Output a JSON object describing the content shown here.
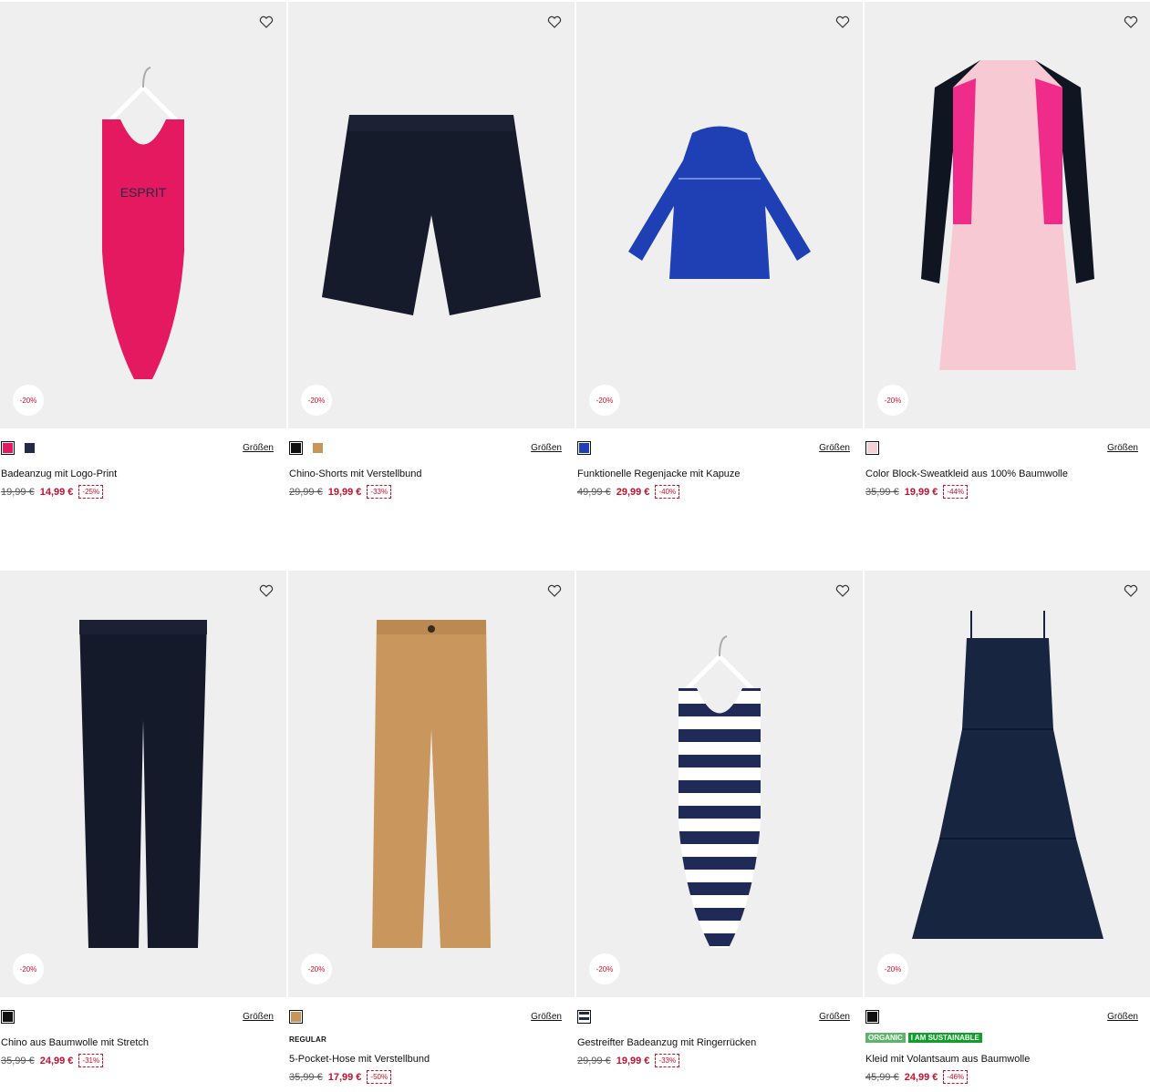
{
  "labels": {
    "sizes": "Größen"
  },
  "colors": {
    "sale": "#c8102e",
    "panel": "#efefef"
  },
  "products": [
    {
      "name": "Badeanzug mit Logo-Print",
      "old": "19,99 €",
      "new": "14,99 €",
      "pct": "-25%",
      "badge": "-20%",
      "swatches": [
        "#e5195f",
        "#222b45"
      ],
      "icon": "swimsuit-pink"
    },
    {
      "name": "Chino-Shorts mit Verstellbund",
      "old": "29,99 €",
      "new": "19,99 €",
      "pct": "-33%",
      "badge": "-20%",
      "swatches": [
        "#111111",
        "#c8955a"
      ],
      "icon": "shorts-black"
    },
    {
      "name": "Funktionelle Regenjacke mit Kapuze",
      "old": "49,99 €",
      "new": "29,99 €",
      "pct": "-40%",
      "badge": "-20%",
      "swatches": [
        "#1f3fb5"
      ],
      "icon": "rain-jacket-blue"
    },
    {
      "name": "Color Block-Sweatkleid aus 100% Baumwolle",
      "old": "35,99 €",
      "new": "19,99 €",
      "pct": "-44%",
      "badge": "-20%",
      "swatches": [
        "#f5d0d7"
      ],
      "icon": "sweat-dress-pink"
    },
    {
      "name": "Chino aus Baumwolle mit Stretch",
      "old": "35,99 €",
      "new": "24,99 €",
      "pct": "-31%",
      "badge": "-20%",
      "swatches": [
        "#111111"
      ],
      "icon": "chino-navy"
    },
    {
      "name": "5-Pocket-Hose mit Verstellbund",
      "tag": "REGULAR",
      "old": "35,99 €",
      "new": "17,99 €",
      "pct": "-50%",
      "badge": "-20%",
      "swatches": [
        "#c8955a"
      ],
      "icon": "pants-camel"
    },
    {
      "name": "Gestreifter Badeanzug mit Ringerrücken",
      "old": "29,99 €",
      "new": "19,99 €",
      "pct": "-33%",
      "badge": "-20%",
      "swatches": [
        "#222b45"
      ],
      "icon": "swimsuit-striped"
    },
    {
      "name": "Kleid mit Volantsaum aus Baumwolle",
      "labels": [
        "ORGANIC",
        "I AM SUSTAINABLE"
      ],
      "old": "45,99 €",
      "new": "24,99 €",
      "pct": "-46%",
      "badge": "-20%",
      "swatches": [
        "#111111"
      ],
      "icon": "tiered-dress-navy"
    }
  ]
}
